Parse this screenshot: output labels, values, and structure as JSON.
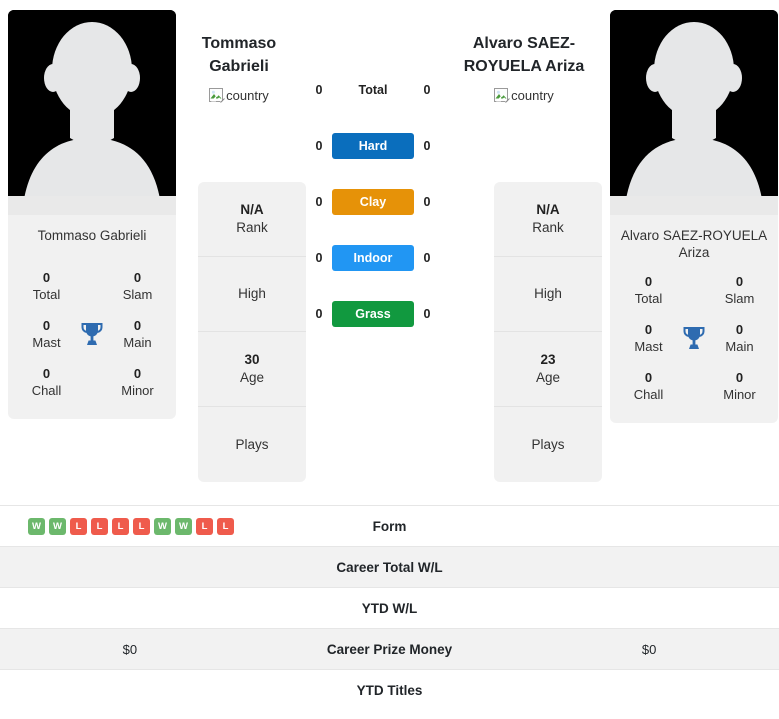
{
  "players": {
    "left": {
      "header_name": "Tommaso Gabrieli",
      "card_name": "Tommaso Gabrieli",
      "country_alt": "country",
      "titles": [
        {
          "num": "0",
          "label": "Total"
        },
        {
          "num": "0",
          "label": "Slam"
        },
        {
          "num": "0",
          "label": "Mast"
        },
        {
          "num": "0",
          "label": "Main"
        },
        {
          "num": "0",
          "label": "Chall"
        },
        {
          "num": "0",
          "label": "Minor"
        }
      ],
      "info": [
        {
          "value": "N/A",
          "label": "Rank"
        },
        {
          "value": "",
          "label": "High"
        },
        {
          "value": "30",
          "label": "Age"
        },
        {
          "value": "",
          "label": "Plays"
        }
      ],
      "form": [
        "W",
        "W",
        "L",
        "L",
        "L",
        "L",
        "W",
        "W",
        "L",
        "L"
      ],
      "career_total_wl": "",
      "ytd_wl": "",
      "career_prize_money": "$0",
      "ytd_titles": ""
    },
    "right": {
      "header_name": "Alvaro SAEZ-ROYUELA Ariza",
      "card_name": "Alvaro SAEZ-ROYUELA Ariza",
      "country_alt": "country",
      "titles": [
        {
          "num": "0",
          "label": "Total"
        },
        {
          "num": "0",
          "label": "Slam"
        },
        {
          "num": "0",
          "label": "Mast"
        },
        {
          "num": "0",
          "label": "Main"
        },
        {
          "num": "0",
          "label": "Chall"
        },
        {
          "num": "0",
          "label": "Minor"
        }
      ],
      "info": [
        {
          "value": "N/A",
          "label": "Rank"
        },
        {
          "value": "",
          "label": "High"
        },
        {
          "value": "23",
          "label": "Age"
        },
        {
          "value": "",
          "label": "Plays"
        }
      ],
      "form": [],
      "career_total_wl": "",
      "ytd_wl": "",
      "career_prize_money": "$0",
      "ytd_titles": ""
    }
  },
  "head_to_head": [
    {
      "left": "0",
      "label": "Total",
      "right": "0",
      "type": "plain",
      "color": ""
    },
    {
      "left": "0",
      "label": "Hard",
      "right": "0",
      "type": "badge",
      "color": "#0a6ebd"
    },
    {
      "left": "0",
      "label": "Clay",
      "right": "0",
      "type": "badge",
      "color": "#e69208"
    },
    {
      "left": "0",
      "label": "Indoor",
      "right": "0",
      "type": "badge",
      "color": "#2196f3"
    },
    {
      "left": "0",
      "label": "Grass",
      "right": "0",
      "type": "badge",
      "color": "#11993f"
    }
  ],
  "stats_rows": [
    {
      "label": "Form",
      "left": "",
      "right": "",
      "striped": false,
      "is_form": true
    },
    {
      "label": "Career Total W/L",
      "left": "",
      "right": "",
      "striped": true,
      "is_form": false
    },
    {
      "label": "YTD W/L",
      "left": "",
      "right": "",
      "striped": false,
      "is_form": false
    },
    {
      "label": "Career Prize Money",
      "left": "$0",
      "right": "$0",
      "striped": true,
      "is_form": false
    },
    {
      "label": "YTD Titles",
      "left": "",
      "right": "",
      "striped": false,
      "is_form": false
    }
  ],
  "colors": {
    "card_bg": "#f1f1f1",
    "stripe": "#f2f2f2",
    "win_badge": "#6cb86c",
    "loss_badge": "#ef5b4c",
    "trophy": "#2e6bb0"
  }
}
